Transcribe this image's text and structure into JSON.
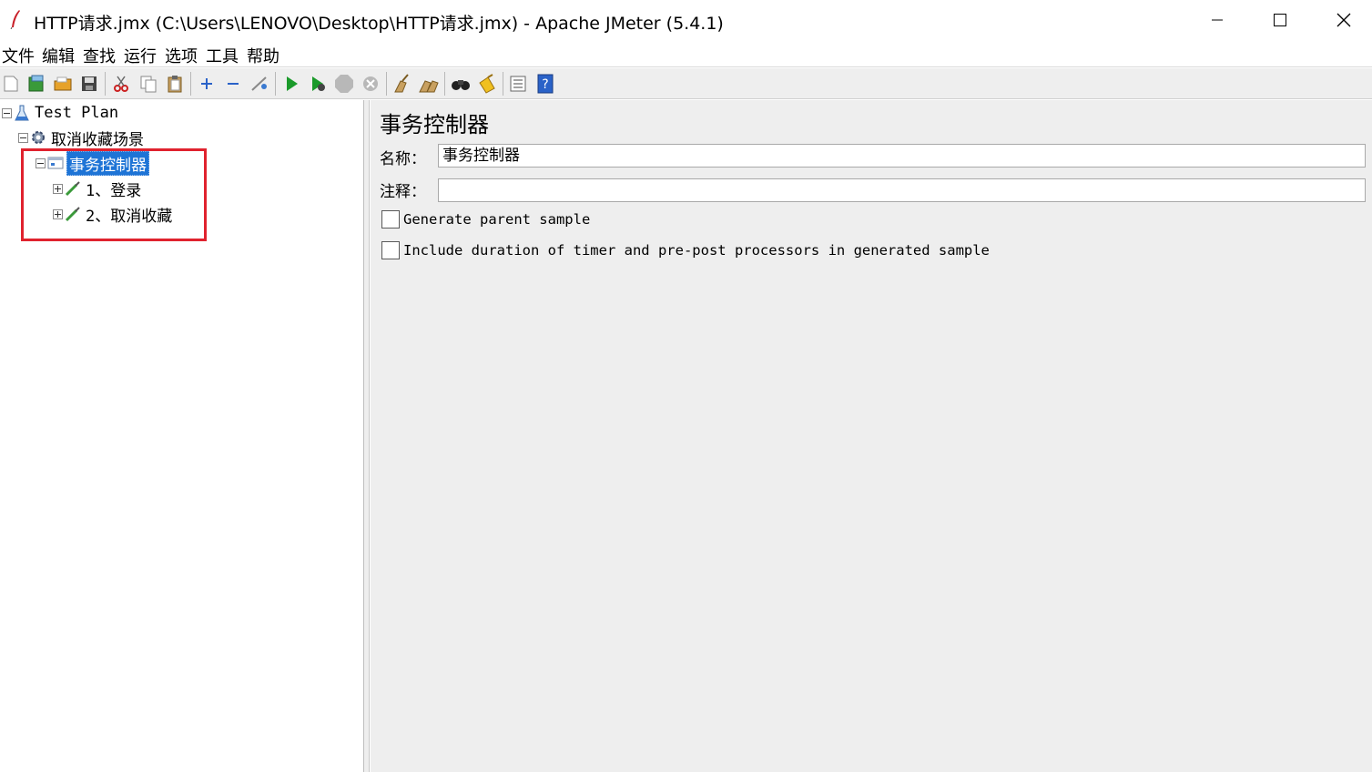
{
  "window": {
    "title": "HTTP请求.jmx (C:\\Users\\LENOVO\\Desktop\\HTTP请求.jmx) - Apache JMeter (5.4.1)"
  },
  "menu": {
    "items": [
      "文件",
      "编辑",
      "查找",
      "运行",
      "选项",
      "工具",
      "帮助"
    ]
  },
  "toolbar": {
    "buttons": [
      "new-icon",
      "templates-icon",
      "open-icon",
      "save-icon",
      "cut-icon",
      "copy-icon",
      "paste-icon",
      "expand-icon",
      "collapse-icon",
      "toggle-icon",
      "start-icon",
      "start-no-pause-icon",
      "stop-icon",
      "shutdown-icon",
      "clear-icon",
      "clear-all-icon",
      "search-icon",
      "reset-search-icon",
      "function-helper-icon",
      "help-icon"
    ]
  },
  "tree": {
    "nodes": [
      {
        "label": "Test Plan",
        "icon": "test-plan-icon",
        "expander": "minus"
      },
      {
        "label": "取消收藏场景",
        "icon": "thread-group-gear-icon",
        "expander": "minus"
      },
      {
        "label": "事务控制器",
        "icon": "transaction-controller-icon",
        "expander": "minus",
        "selected": true
      },
      {
        "label": "1、登录",
        "icon": "http-sampler-pipette-icon",
        "expander": "plus"
      },
      {
        "label": "2、取消收藏",
        "icon": "http-sampler-pipette-icon",
        "expander": "plus"
      }
    ],
    "highlight_color": "#e0222e"
  },
  "panel": {
    "title": "事务控制器",
    "name_label": "名称：",
    "name_value": "事务控制器",
    "comment_label": "注释：",
    "comment_value": "",
    "checkbox_generate_parent": "Generate parent sample",
    "checkbox_include_duration": "Include duration of timer and pre-post processors in generated sample"
  },
  "colors": {
    "selection": "#1e74d6",
    "panel_bg": "#eeeeee"
  }
}
